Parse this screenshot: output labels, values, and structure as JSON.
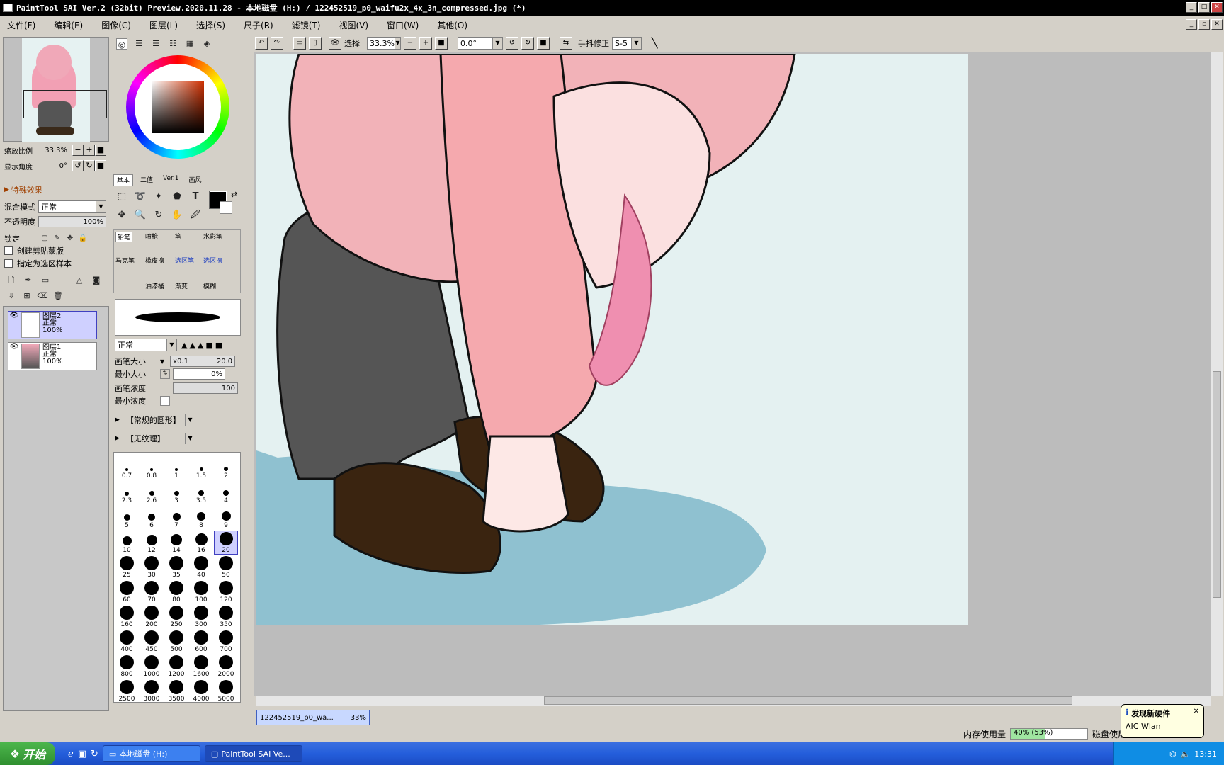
{
  "window": {
    "title": "PaintTool SAI Ver.2 (32bit) Preview.2020.11.28 - 本地磁盘 (H:) / 122452519_p0_waifu2x_4x_3n_compressed.jpg (*)"
  },
  "menu": [
    "文件(F)",
    "编辑(E)",
    "图像(C)",
    "图层(L)",
    "选择(S)",
    "尺子(R)",
    "滤镜(T)",
    "视图(V)",
    "窗口(W)",
    "其他(O)"
  ],
  "navigator": {
    "zoom_label": "缩放比例",
    "zoom_value": "33.3%",
    "angle_label": "显示角度",
    "angle_value": "0°"
  },
  "layer_props": {
    "effects": "特殊效果",
    "blend_label": "混合模式",
    "blend_value": "正常",
    "opacity_label": "不透明度",
    "opacity_value": "100%",
    "lock_label": "锁定",
    "clip_label": "创建剪贴蒙版",
    "select_sample_label": "指定为选区样本"
  },
  "layers": [
    {
      "name": "图层2",
      "mode": "正常",
      "opacity": "100%",
      "selected": true
    },
    {
      "name": "图层1",
      "mode": "正常",
      "opacity": "100%",
      "selected": false
    }
  ],
  "color_tabs": [
    "基本",
    "二值",
    "Ver.1",
    "画风"
  ],
  "brushes": {
    "row1": [
      "铅笔",
      "喷枪",
      "笔",
      "水彩笔"
    ],
    "row2": [
      "马克笔",
      "橡皮擦",
      "选区笔",
      "选区擦"
    ],
    "row3": [
      "油漆桶",
      "渐变",
      "模糊"
    ]
  },
  "brush_settings": {
    "mode": "正常",
    "size_label": "画笔大小",
    "size_mult": "x0.1",
    "size_value": "20.0",
    "min_size_label": "最小大小",
    "min_size_value": "0%",
    "density_label": "画笔浓度",
    "density_value": "100",
    "min_density_label": "最小浓度",
    "shape": "【常规的圆形】",
    "texture": "【无纹理】"
  },
  "size_presets": [
    "0.7",
    "0.8",
    "1",
    "1.5",
    "2",
    "2.3",
    "2.6",
    "3",
    "3.5",
    "4",
    "5",
    "6",
    "7",
    "8",
    "9",
    "10",
    "12",
    "14",
    "16",
    "20",
    "25",
    "30",
    "35",
    "40",
    "50",
    "60",
    "70",
    "80",
    "100",
    "120",
    "160",
    "200",
    "250",
    "300",
    "350",
    "400",
    "450",
    "500",
    "600",
    "700",
    "800",
    "1000",
    "1200",
    "1600",
    "2000",
    "2500",
    "3000",
    "3500",
    "4000",
    "5000"
  ],
  "selected_size": "20",
  "toolbar": {
    "select_label": "选择",
    "zoom": "33.3%",
    "angle": "0.0°",
    "stabilizer_label": "手抖修正",
    "stabilizer_value": "S-5"
  },
  "doc_tab": {
    "name": "122452519_p0_wa...",
    "zoom": "33%"
  },
  "status": {
    "memory_label": "内存使用量",
    "memory_value": "40% (53%)",
    "memory_fraction": 0.44,
    "disk_label": "磁盘使用"
  },
  "balloon": {
    "title": "发现新硬件",
    "body": "AIC Wlan"
  },
  "taskbar": {
    "start": "开始",
    "tasks": [
      "本地磁盘 (H:)",
      "PaintTool SAI Ve..."
    ],
    "clock": "13:31"
  }
}
